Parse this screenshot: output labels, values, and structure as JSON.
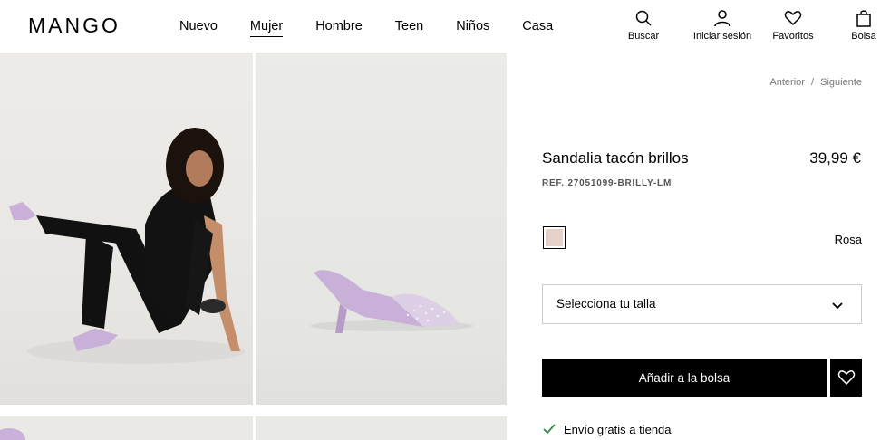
{
  "header": {
    "logo": "MANGO",
    "nav": [
      "Nuevo",
      "Mujer",
      "Hombre",
      "Teen",
      "Niños",
      "Casa"
    ],
    "active_nav": "Mujer",
    "tools": {
      "search": "Buscar",
      "login": "Iniciar sesión",
      "favorites": "Favoritos",
      "bag": "Bolsa"
    }
  },
  "breadcrumb": {
    "prev": "Anterior",
    "separator": "/",
    "next": "Siguiente"
  },
  "product": {
    "title": "Sandalia tacón brillos",
    "price": "39,99 €",
    "ref": "REF. 27051099-BRILLY-LM",
    "color": {
      "name": "Rosa",
      "hex": "#e7d2cb"
    },
    "size_placeholder": "Selecciona tu talla",
    "add_to_bag": "Añadir a la bolsa",
    "shipping": "Envío gratis a tienda"
  },
  "colors": {
    "accent_check": "#2f8a46",
    "shoe": "#c9b0d8"
  }
}
